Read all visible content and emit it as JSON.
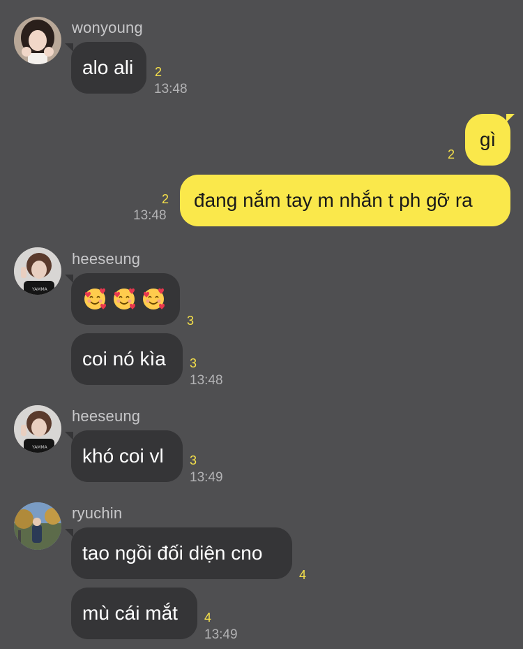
{
  "chat": {
    "messages": [
      {
        "sender": "wonyoung",
        "text": "alo ali",
        "unread": "2",
        "time": "13:48"
      },
      {
        "sender": "me",
        "text": "gì",
        "unread": "2"
      },
      {
        "sender": "me",
        "text": "đang nắm tay m nhắn t ph gỡ ra",
        "unread": "2",
        "time": "13:48"
      },
      {
        "sender": "heeseung",
        "text": "🥰🥰🥰",
        "unread": "3"
      },
      {
        "sender": "heeseung",
        "text": "coi nó kìa",
        "unread": "3",
        "time": "13:48"
      },
      {
        "sender": "heeseung",
        "text": "khó coi vl",
        "unread": "3",
        "time": "13:49"
      },
      {
        "sender": "ryuchin",
        "text": "tao ngồi đối diện cno",
        "unread": "4"
      },
      {
        "sender": "ryuchin",
        "text": "mù cái mắt",
        "unread": "4",
        "time": "13:49"
      }
    ],
    "names": {
      "wonyoung": "wonyoung",
      "heeseung_1": "heeseung",
      "heeseung_2": "heeseung",
      "ryuchin": "ryuchin"
    }
  },
  "colors": {
    "background": "#4f4f51",
    "incoming_bubble": "#353537",
    "outgoing_bubble": "#fae84b",
    "unread_count": "#f5e04a",
    "timestamp": "#b3b3b5"
  },
  "icons": {
    "emoji": "smiling-face-with-hearts"
  }
}
